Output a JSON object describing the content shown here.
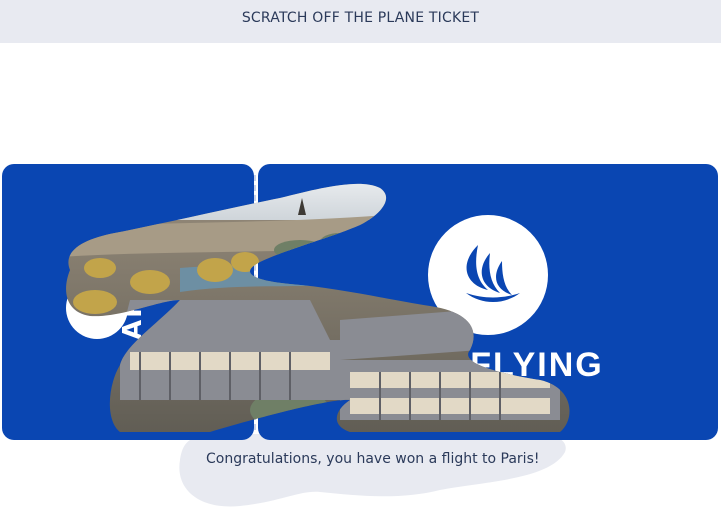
{
  "header": {
    "title": "SCRATCH OFF THE PLANE TICKET"
  },
  "ticket": {
    "brand_color": "#0a46b2",
    "stub_brand_text": "ART",
    "main_brand_text": "T FLYING",
    "logo_icon": "wing-logo-icon"
  },
  "scratch_area": {
    "revealed_image": "paris-cityscape-with-eiffel-tower-and-seine"
  },
  "result": {
    "message": "Congratulations, you have won a flight to Paris!",
    "backdrop_color": "#e8eaf1"
  }
}
